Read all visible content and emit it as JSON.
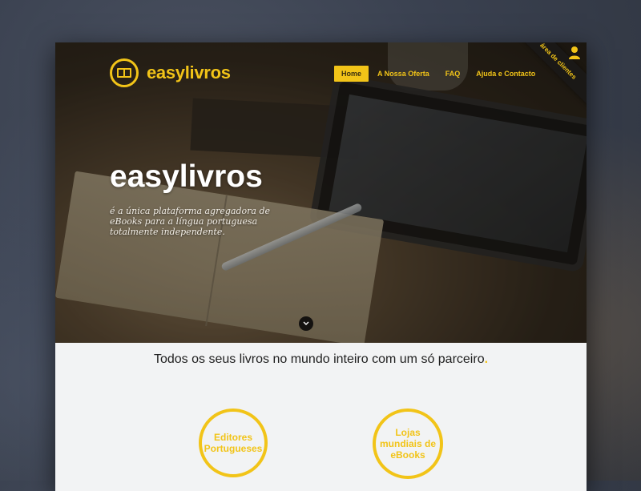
{
  "brand": {
    "name": "easylivros",
    "color": "#f2c418"
  },
  "nav": {
    "items": [
      {
        "label": "Home",
        "active": true
      },
      {
        "label": "A Nossa Oferta",
        "active": false
      },
      {
        "label": "FAQ",
        "active": false
      },
      {
        "label": "Ajuda e Contacto",
        "active": false
      }
    ]
  },
  "corner_ribbon": {
    "label": "área de clientes",
    "icon": "user-icon"
  },
  "hero": {
    "title": "easylivros",
    "subtitle": "é a única plataforma agregadora de eBooks para a língua portuguesa totalmente independente.",
    "scroll_icon": "chevron-down-icon"
  },
  "tagline": {
    "text": "Todos os seus livros no mundo inteiro com um só parceiro",
    "punct": "."
  },
  "features": [
    {
      "label": "Editores Portugueses"
    },
    {
      "label": "Lojas mundiais de eBooks"
    }
  ]
}
